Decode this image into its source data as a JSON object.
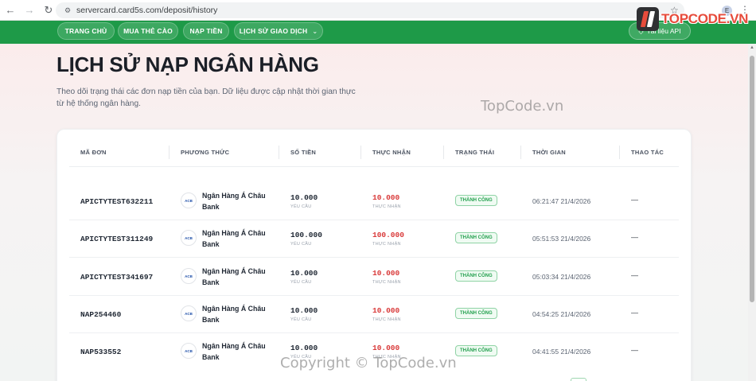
{
  "browser": {
    "url": "servercard.card5s.com/deposit/history",
    "profile_initial": "E"
  },
  "logo": {
    "text": "TOPCODE.VN"
  },
  "navbar": {
    "items": [
      {
        "label": "TRANG CHỦ"
      },
      {
        "label": "MUA THẺ CÀO"
      },
      {
        "label": "NẠP TIỀN"
      },
      {
        "label": "LỊCH SỬ GIAO DỊCH"
      }
    ],
    "api_label": "Tài liệu API"
  },
  "page": {
    "title": "LỊCH SỬ NẠP NGÂN HÀNG",
    "description": "Theo dõi trạng thái các đơn nạp tiền của bạn. Dữ liệu được cập nhật thời gian thực từ hệ thống ngân hàng."
  },
  "watermark": "TopCode.vn",
  "copyright": "Copyright © TopCode.vn",
  "table": {
    "headers": [
      "MÃ ĐƠN",
      "PHƯƠNG THỨC",
      "SỐ TIỀN",
      "THỰC NHẬN",
      "TRẠNG THÁI",
      "THỜI GIAN",
      "THAO TÁC"
    ],
    "amount_sub": "YÊU CẦU",
    "received_sub": "THỰC NHẬN",
    "rows": [
      {
        "id": "APICTYTEST632211",
        "bank_logo": "ACB",
        "bank_line1": "Ngân Hàng Á Châu",
        "bank_line2": "Bank",
        "amount": "10.000",
        "received": "10.000",
        "status": "THÀNH CÔNG",
        "time": "06:21:47 21/4/2026",
        "action": "—"
      },
      {
        "id": "APICTYTEST311249",
        "bank_logo": "ACB",
        "bank_line1": "Ngân Hàng Á Châu",
        "bank_line2": "Bank",
        "amount": "100.000",
        "received": "100.000",
        "status": "THÀNH CÔNG",
        "time": "05:51:53 21/4/2026",
        "action": "—"
      },
      {
        "id": "APICTYTEST341697",
        "bank_logo": "ACB",
        "bank_line1": "Ngân Hàng Á Châu",
        "bank_line2": "Bank",
        "amount": "10.000",
        "received": "10.000",
        "status": "THÀNH CÔNG",
        "time": "05:03:34 21/4/2026",
        "action": "—"
      },
      {
        "id": "NAP254460",
        "bank_logo": "ACB",
        "bank_line1": "Ngân Hàng Á Châu",
        "bank_line2": "Bank",
        "amount": "10.000",
        "received": "10.000",
        "status": "THÀNH CÔNG",
        "time": "04:54:25 21/4/2026",
        "action": "—"
      },
      {
        "id": "NAP533552",
        "bank_logo": "ACB",
        "bank_line1": "Ngân Hàng Á Châu",
        "bank_line2": "Bank",
        "amount": "10.000",
        "received": "10.000",
        "status": "THÀNH CÔNG",
        "time": "04:41:55 21/4/2026",
        "action": "—"
      }
    ]
  },
  "colors": {
    "navbar": "#1e9a48",
    "received": "#d93a3a",
    "success": "#23a04e",
    "logo_text": "#e74c3c"
  }
}
